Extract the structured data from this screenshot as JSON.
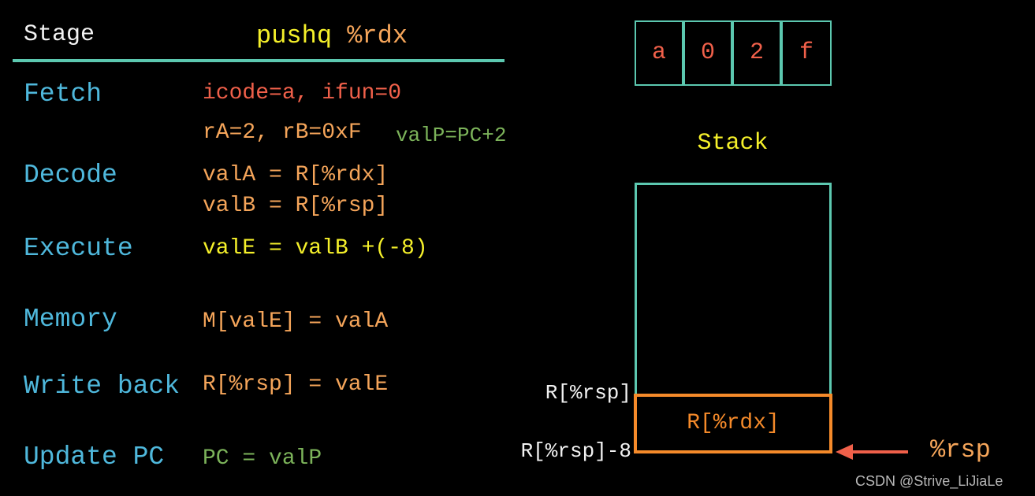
{
  "header": {
    "stage_label": "Stage",
    "instr_op": "pushq",
    "instr_reg": "%rdx"
  },
  "stages": [
    {
      "name": "Fetch",
      "lines": [
        "icode=a, ifun=0",
        "rA=2, rB=0xF"
      ],
      "extra": "valP=PC+2"
    },
    {
      "name": "Decode",
      "lines": [
        "valA = R[%rdx]",
        "valB = R[%rsp]"
      ]
    },
    {
      "name": "Execute",
      "lines": [
        "valE = valB +(-8)"
      ]
    },
    {
      "name": "Memory",
      "lines": [
        "M[valE] = valA"
      ]
    },
    {
      "name": "Write back",
      "lines": [
        "R[%rsp] = valE"
      ]
    },
    {
      "name": "Update PC",
      "lines": [
        "PC = valP"
      ]
    }
  ],
  "encoding": [
    "a",
    "0",
    "2",
    "f"
  ],
  "stack": {
    "title": "Stack",
    "top_label": "R[%rsp]",
    "bottom_label": "R[%rsp]-8",
    "pushed_value": "R[%rdx]",
    "pointer_label": "%rsp"
  },
  "watermark": "CSDN @Strive_LiJiaLe",
  "colors": {
    "teal": "#5cc8b0",
    "stage_blue": "#4fb8dc",
    "red": "#f0604a",
    "orange": "#f5a55a",
    "yellow": "#f5f02a",
    "green": "#7cb35a",
    "box_orange": "#f58a2a"
  }
}
